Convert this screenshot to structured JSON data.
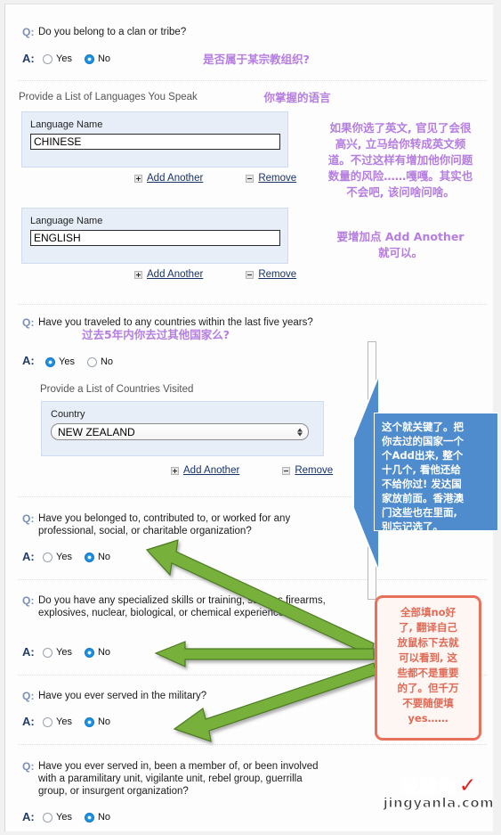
{
  "form": {
    "q_prefix": "Q:",
    "a_prefix": "A:",
    "questions": [
      {
        "id": "clan-tribe",
        "text": "Do you belong to a clan or tribe?",
        "yes": "Yes",
        "no": "No",
        "selected": "no"
      },
      {
        "id": "traveled-countries",
        "text": "Have you traveled to any countries within the last five years?",
        "yes": "Yes",
        "no": "No",
        "selected": "yes"
      },
      {
        "id": "organization",
        "text": "Have you belonged to, contributed to, or worked for any professional, social, or charitable organization?",
        "yes": "Yes",
        "no": "No",
        "selected": "no"
      },
      {
        "id": "specialized-skills",
        "text": "Do you have any specialized skills or training, such as firearms, explosives, nuclear, biological, or chemical experience?",
        "yes": "Yes",
        "no": "No",
        "selected": "no"
      },
      {
        "id": "military",
        "text": "Have you ever served in the military?",
        "yes": "Yes",
        "no": "No",
        "selected": "no"
      },
      {
        "id": "paramilitary",
        "text": "Have you ever served in, been a member of, or been involved with a paramilitary unit, vigilante unit, rebel group, guerrilla group, or insurgent organization?",
        "yes": "Yes",
        "no": "No",
        "selected": "no"
      }
    ],
    "languages_section": {
      "heading": "Provide a List of Languages You Speak",
      "field_label": "Language Name",
      "entries": [
        {
          "value": "CHINESE"
        },
        {
          "value": "ENGLISH"
        }
      ],
      "add_label": "Add Another",
      "remove_label": "Remove"
    },
    "countries_section": {
      "heading": "Provide a List of Countries Visited",
      "field_label": "Country",
      "selected_country": "NEW ZEALAND",
      "add_label": "Add Another",
      "remove_label": "Remove"
    }
  },
  "annotations": {
    "clan_note": "是否属于某宗教组织?",
    "languages_note": "你掌握的语言",
    "english_note": "如果你选了英文, 官见了会很\n高兴, 立马给你转成英文频\n道。不过这样有增加他你问题\n数量的风险……嘎嘎。其实也\n不会吧, 该问啥问啥。",
    "add_another_note": "要增加点 Add Another\n就可以。",
    "travel_note": "过去5年内你去过其他国家么?",
    "countries_callout": "这个就关键了。把\n你去过的国家一个\n个Add出来, 整个\n十几个, 看他还给\n不给你过! 发达国\n家放前面。香港澳\n门这些也在里面,\n别忘记选了。",
    "no_answers_callout": "全部填no好\n了, 翻译自己\n放鼠标下去就\n可以看到, 这\n些都不是重要\n的了。但千万\n不要随便填\nyes……"
  },
  "watermark": {
    "name": "经验啦",
    "check": "✓",
    "url": "jingyanla.com"
  },
  "colors": {
    "q_label": "#7b90b5",
    "a_label": "#223c66",
    "radio_selected": "#1e90e0",
    "annotation_purple": "#b57de0",
    "callout_blue": "#4f8ccd",
    "callout_red": "#e9705a",
    "arrow_green": "#77b03a"
  }
}
